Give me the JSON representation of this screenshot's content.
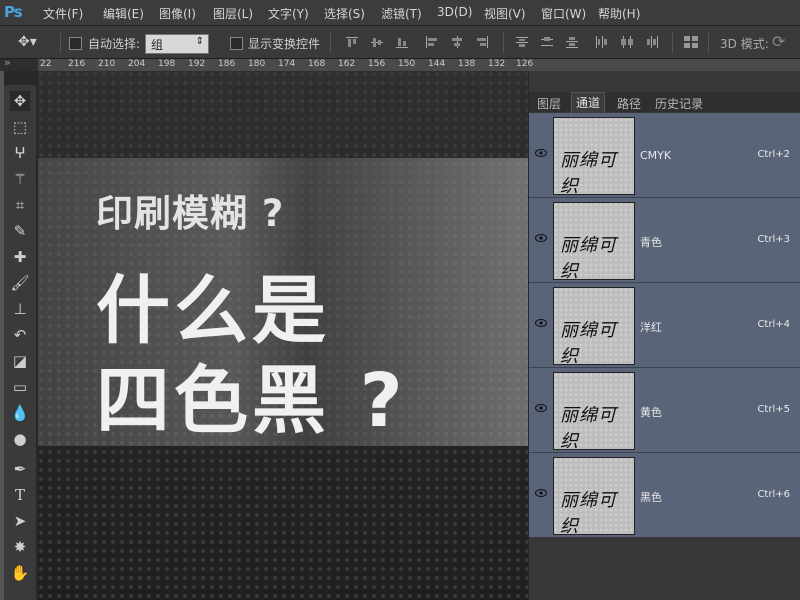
{
  "menubar": {
    "logo": "Ps",
    "items": [
      "文件(F)",
      "编辑(E)",
      "图像(I)",
      "图层(L)",
      "文字(Y)",
      "选择(S)",
      "滤镜(T)",
      "3D(D)",
      "视图(V)",
      "窗口(W)",
      "帮助(H)"
    ]
  },
  "options": {
    "auto_select_label": "自动选择:",
    "auto_select_value": "组",
    "show_transform_label": "显示变换控件",
    "mode_3d_label": "3D 模式:"
  },
  "ruler": {
    "ticks": [
      "22",
      "216",
      "210",
      "204",
      "198",
      "192",
      "186",
      "180",
      "174",
      "168",
      "162",
      "156",
      "150",
      "144",
      "138",
      "132",
      "126"
    ]
  },
  "canvas": {
    "line1": "印刷模糊 ?",
    "line2": "什么是",
    "line3": "四色黑 ?"
  },
  "panel": {
    "tabs": [
      "图层",
      "通道",
      "路径",
      "历史记录"
    ],
    "active_tab": "通道",
    "thumb_text": "丽绵可织",
    "channels": [
      {
        "name": "CMYK",
        "shortcut": "Ctrl+2"
      },
      {
        "name": "青色",
        "shortcut": "Ctrl+3"
      },
      {
        "name": "洋红",
        "shortcut": "Ctrl+4"
      },
      {
        "name": "黄色",
        "shortcut": "Ctrl+5"
      },
      {
        "name": "黑色",
        "shortcut": "Ctrl+6"
      }
    ]
  },
  "colors": {
    "channel_row": "#5a6478",
    "menubar": "#3c3c3c",
    "logo": "#4aa3df"
  }
}
